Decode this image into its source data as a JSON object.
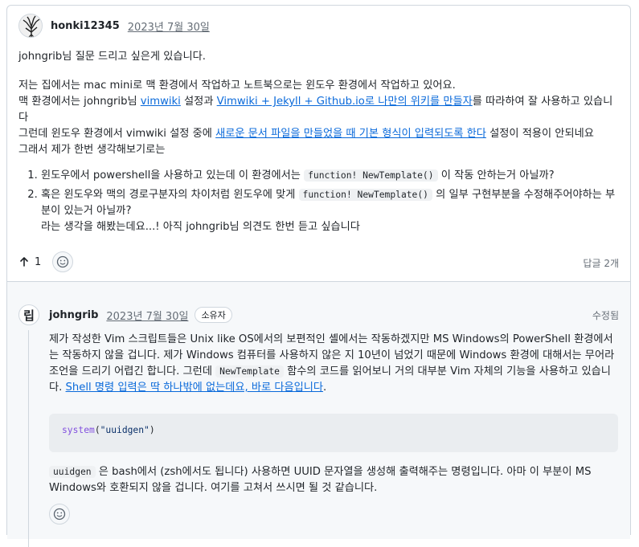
{
  "post": {
    "author": "honki12345",
    "date": "2023년 7월 30일",
    "line1": "johngrib님 질문 드리고 싶은게 있습니다.",
    "line2": "저는 집에서는 mac mini로 맥 환경에서 작업하고 노트북으로는 윈도우 환경에서 작업하고 있어요.",
    "line3_pre": "맥 환경에서는 johngrib님 ",
    "line3_link1": "vimwiki",
    "line3_mid": " 설정과 ",
    "line3_link2": "Vimwiki + Jekyll + Github.io로 나만의 위키를 만들자",
    "line3_post": "를 따라하여 잘 사용하고 있습니다",
    "line4_pre": "그런데 윈도우 환경에서 vimwiki 설정 중에 ",
    "line4_link": "새로운 문서 파일을 만들었을 때 기본 형식이 입력되도록 한다",
    "line4_post": " 설정이 적용이 안되네요",
    "line5": "그래서 제가 한번 생각해보기로는",
    "list": [
      {
        "pre": "윈도우에서 powershell을 사용하고 있는데 이 환경에서는 ",
        "code": "function! NewTemplate()",
        "post": " 이 작동 안하는거 아닐까?"
      },
      {
        "pre": "혹은 윈도우와 맥의 경로구분자의 차이처럼 윈도우에 맞게 ",
        "code": "function! NewTemplate()",
        "post": " 의 일부 구현부분을 수정해주어야하는 부분이 있는거 아닐까?",
        "extra": "라는 생각을 해봤는데요...! 아직 johngrib님 의견도 한번 듣고 싶습니다"
      }
    ],
    "upvotes": "1",
    "reply_count": "답글 2개"
  },
  "reply": {
    "avatar_glyph": "립",
    "author": "johngrib",
    "date": "2023년 7월 30일",
    "badge": "소유자",
    "edited": "수정됨",
    "p1_a": "제가 작성한 Vim 스크립트들은 Unix like OS에서의 보편적인 셸에서는 작동하겠지만 MS Windows의 PowerShell 환경에서는 작동하지 않을 겁니다. 제가 Windows 컴퓨터를 사용하지 않은 지 10년이 넘었기 때문에 Windows 환경에 대해서는 무어라 조언을 드리기 어렵긴 합니다. 그런데 ",
    "p1_code": "NewTemplate",
    "p1_b": " 함수의 코드를 읽어보니 거의 대부분 Vim 자체의 기능을 사용하고 있습니다. ",
    "p1_link": "Shell 명령 입력은 딱 하나밖에 없는데요, 바로 다음입니다",
    "p1_end": ".",
    "code_fn": "system",
    "code_open": "(",
    "code_str": "\"uuidgen\"",
    "code_close": ")",
    "p2_code": "uuidgen",
    "p2_text": " 은 bash에서 (zsh에서도 됩니다) 사용하면 UUID 문자열을 생성해 출력해주는 명령입니다. 아마 이 부분이 MS Windows와 호환되지 않을 겁니다. 여기를 고쳐서 쓰시면 될 것 같습니다."
  },
  "icons": {
    "upvote": "arrow-up-icon",
    "reaction": "smiley-icon"
  }
}
